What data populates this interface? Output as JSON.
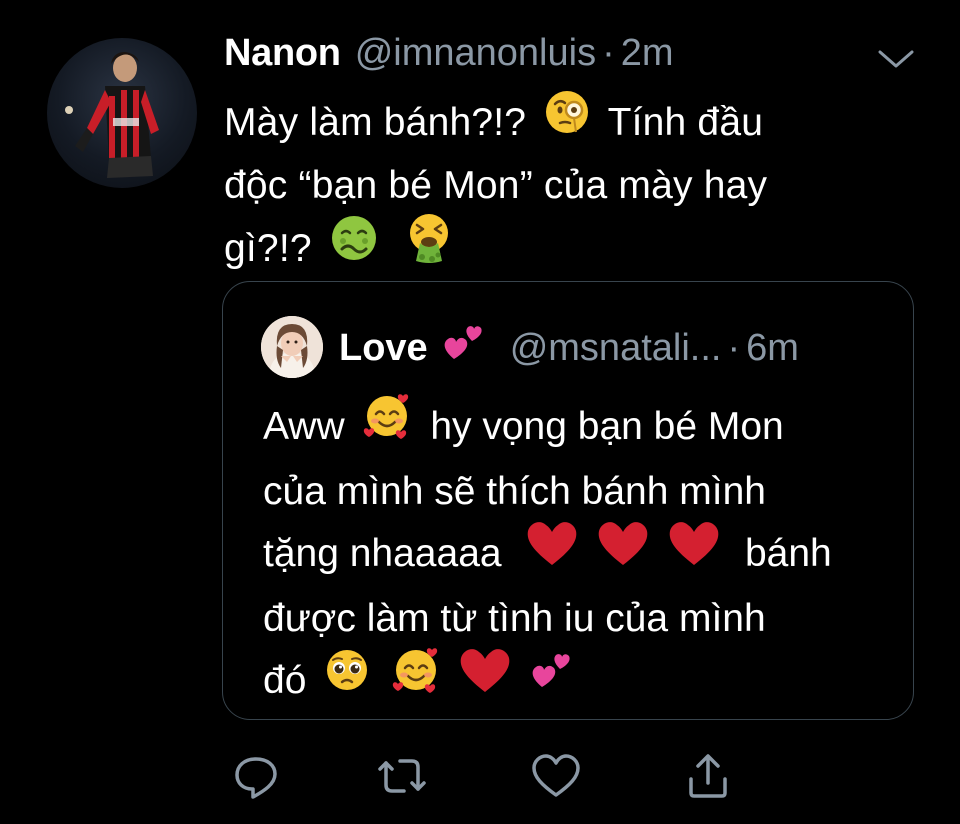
{
  "tweet": {
    "display_name": "Nanon",
    "handle": "@imnanonluis",
    "separator": "·",
    "time": "2m",
    "text_lines": [
      {
        "before": "Mày làm bánh?!?",
        "emoji": "face-with-monocle",
        "after": "Tính đầu"
      },
      {
        "text": "độc “bạn bé Mon” của mày hay"
      },
      {
        "before": "gì?!?",
        "emoji": "nauseated-face",
        "emoji2": "face-vomiting"
      }
    ]
  },
  "quoted_tweet": {
    "display_name": "Love",
    "name_emoji": "two-hearts",
    "handle": "@msnatali...",
    "separator": "·",
    "time": "6m",
    "text_lines": [
      {
        "before": "Aww",
        "emoji": "smiling-face-with-hearts",
        "after": "hy vọng bạn bé Mon"
      },
      {
        "text": "của mình sẽ thích bánh mình"
      },
      {
        "before": "tặng nhaaaaa",
        "emojis": [
          "red-heart",
          "red-heart",
          "red-heart"
        ],
        "after": "bánh"
      },
      {
        "text": "được làm từ tình iu của mình"
      },
      {
        "before": "đó",
        "emojis": [
          "pleading-face",
          "smiling-face-with-hearts",
          "red-heart",
          "two-hearts"
        ]
      }
    ]
  },
  "actions": [
    {
      "icon": "reply-icon"
    },
    {
      "icon": "retweet-icon"
    },
    {
      "icon": "like-icon"
    },
    {
      "icon": "share-icon"
    }
  ],
  "colors": {
    "background": "#000000",
    "text": "#ffffff",
    "secondary": "#8b98a5",
    "border": "#38444d",
    "heart": "#d42030",
    "pink": "#e8459c"
  }
}
